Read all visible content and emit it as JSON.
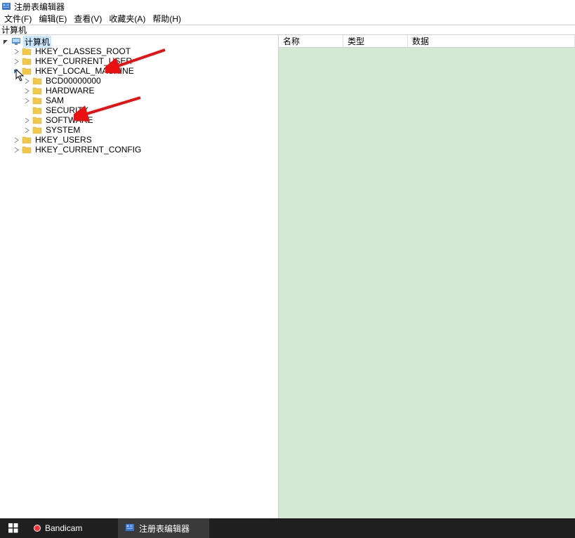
{
  "window": {
    "title": "注册表编辑器"
  },
  "menu": {
    "file": "文件(F)",
    "edit": "编辑(E)",
    "view": "查看(V)",
    "favorites": "收藏夹(A)",
    "help": "帮助(H)"
  },
  "address": {
    "path": "计算机"
  },
  "tree": {
    "root": "计算机",
    "items": [
      {
        "label": "HKEY_CLASSES_ROOT",
        "children": true
      },
      {
        "label": "HKEY_CURRENT_USER",
        "children": true
      },
      {
        "label": "HKEY_LOCAL_MACHINE",
        "children": true,
        "expanded": true
      },
      {
        "label": "BCD00000000",
        "children": true,
        "parent": 2
      },
      {
        "label": "HARDWARE",
        "children": true,
        "parent": 2
      },
      {
        "label": "SAM",
        "children": true,
        "parent": 2
      },
      {
        "label": "SECURITY",
        "children": false,
        "parent": 2
      },
      {
        "label": "SOFTWARE",
        "children": true,
        "parent": 2
      },
      {
        "label": "SYSTEM",
        "children": true,
        "parent": 2
      },
      {
        "label": "HKEY_USERS",
        "children": true
      },
      {
        "label": "HKEY_CURRENT_CONFIG",
        "children": true
      }
    ]
  },
  "list": {
    "columns": {
      "name": "名称",
      "type": "类型",
      "data": "数据"
    }
  },
  "taskbar": {
    "bandicam": "Bandicam",
    "regedit": "注册表编辑器"
  }
}
